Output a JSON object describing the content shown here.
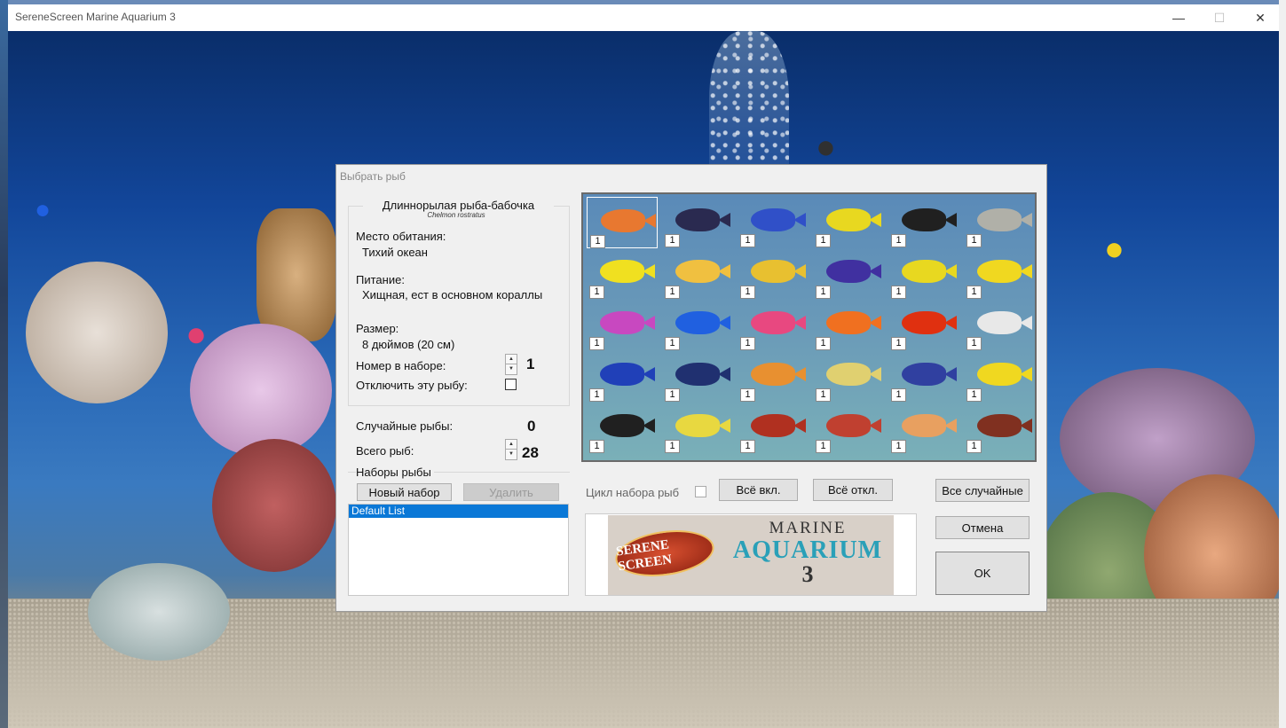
{
  "window": {
    "title": "SereneScreen Marine Aquarium 3",
    "min_icon": "minimize-icon",
    "max_icon": "maximize-icon",
    "close_icon": "close-icon"
  },
  "dialog": {
    "title": "Выбрать рыб",
    "fish_info": {
      "name": "Длиннорылая рыба-бабочка",
      "latin": "Chelmon rostratus",
      "habitat_label": "Место обитания:",
      "habitat_value": "Тихий океан",
      "diet_label": "Питание:",
      "diet_value": "Хищная, ест в основном кораллы",
      "size_label": "Размер:",
      "size_value": "8 дюймов (20 см)",
      "set_number_label": "Номер в наборе:",
      "set_number_value": "1",
      "disable_label": "Отключить эту рыбу:"
    },
    "random_fish_label": "Случайные рыбы:",
    "random_fish_value": "0",
    "total_fish_label": "Всего рыб:",
    "total_fish_value": "28",
    "sets": {
      "label": "Наборы рыбы",
      "new_button": "Новый набор",
      "delete_button": "Удалить",
      "items": [
        "Default List"
      ]
    },
    "cycle_label": "Цикл набора рыб",
    "all_on_button": "Всё вкл.",
    "all_off_button": "Всё откл.",
    "all_random_button": "Все случайные",
    "cancel_button": "Отмена",
    "ok_button": "OK",
    "logo": {
      "left_text": "SERENE SCREEN",
      "marine": "MARINE",
      "aquarium": "AQUARIUM",
      "number": "3"
    },
    "fish_grid": [
      {
        "count": "1",
        "color": "#e87830"
      },
      {
        "count": "1",
        "color": "#2a2a50"
      },
      {
        "count": "1",
        "color": "#3050c8"
      },
      {
        "count": "1",
        "color": "#e8d820"
      },
      {
        "count": "1",
        "color": "#202020"
      },
      {
        "count": "1",
        "color": "#b0b0a8"
      },
      {
        "count": "1",
        "color": "#f0e020"
      },
      {
        "count": "1",
        "color": "#f0c040"
      },
      {
        "count": "1",
        "color": "#e8c030"
      },
      {
        "count": "1",
        "color": "#4030a0"
      },
      {
        "count": "1",
        "color": "#e8d820"
      },
      {
        "count": "1",
        "color": "#f0d820"
      },
      {
        "count": "1",
        "color": "#c848c0"
      },
      {
        "count": "1",
        "color": "#2060e0"
      },
      {
        "count": "1",
        "color": "#e84880"
      },
      {
        "count": "1",
        "color": "#f07020"
      },
      {
        "count": "1",
        "color": "#e03010"
      },
      {
        "count": "1",
        "color": "#e8e8e8"
      },
      {
        "count": "1",
        "color": "#2040b8"
      },
      {
        "count": "1",
        "color": "#203070"
      },
      {
        "count": "1",
        "color": "#e89030"
      },
      {
        "count": "1",
        "color": "#e0d070"
      },
      {
        "count": "1",
        "color": "#3040a0"
      },
      {
        "count": "1",
        "color": "#f0d820"
      },
      {
        "count": "1",
        "color": "#202020"
      },
      {
        "count": "1",
        "color": "#e8d840"
      },
      {
        "count": "1",
        "color": "#b03020"
      },
      {
        "count": "1",
        "color": "#c04030"
      },
      {
        "count": "1",
        "color": "#e8a060"
      },
      {
        "count": "1",
        "color": "#803020"
      }
    ]
  }
}
